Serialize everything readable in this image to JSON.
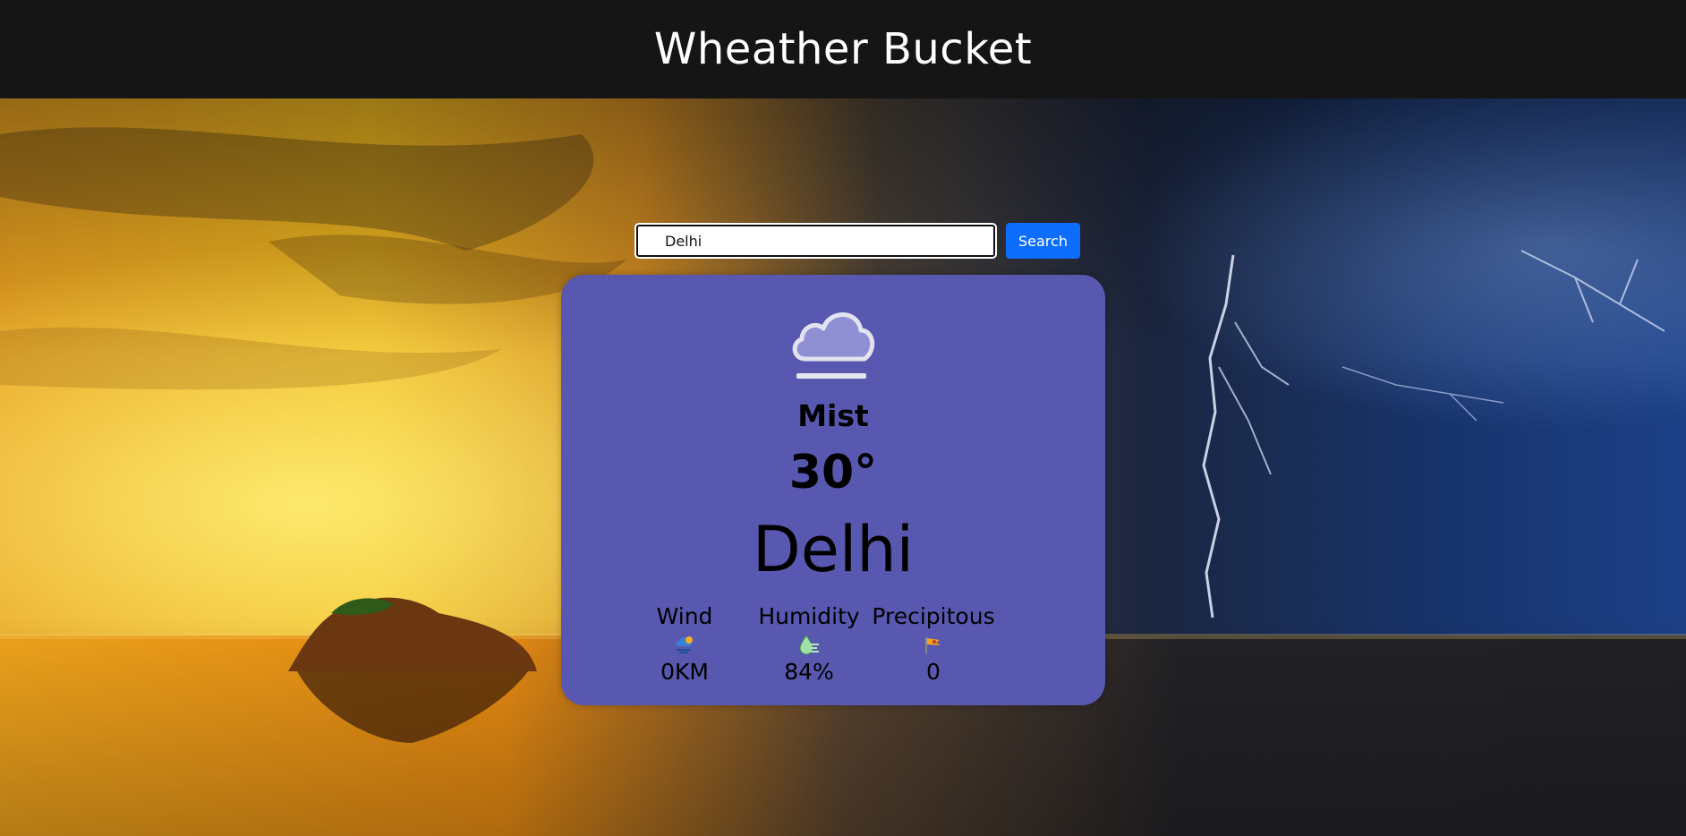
{
  "header": {
    "title": "Wheather Bucket"
  },
  "search": {
    "value": "Delhi",
    "button_label": "Search"
  },
  "weather": {
    "condition": "Mist",
    "temperature": "30°",
    "city": "Delhi",
    "icon": "mist-cloud-icon"
  },
  "stats": [
    {
      "label": "Wind",
      "value": "0KM",
      "icon": "wind-weather-icon"
    },
    {
      "label": "Humidity",
      "value": "84%",
      "icon": "humidity-drop-icon"
    },
    {
      "label": "Precipitous",
      "value": "0",
      "icon": "precipitation-flag-icon"
    }
  ],
  "colors": {
    "header_bg": "#151515",
    "card_bg": "#5858b0",
    "button_bg": "#0d6efd"
  }
}
